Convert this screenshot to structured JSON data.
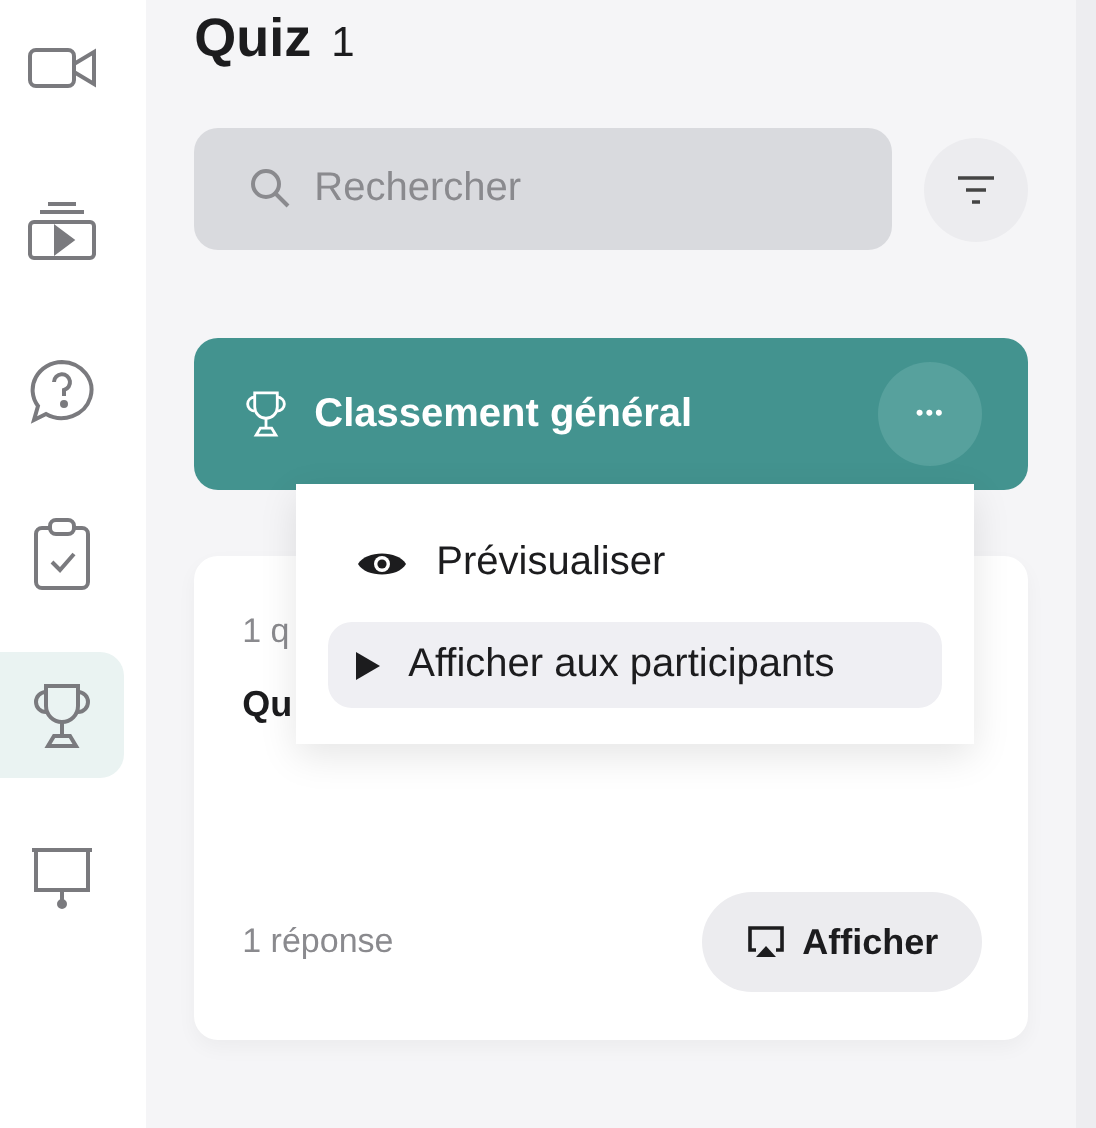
{
  "sidebar": {
    "items": [
      {
        "kind": "video",
        "selected": false
      },
      {
        "kind": "playlist",
        "selected": false
      },
      {
        "kind": "question",
        "selected": false
      },
      {
        "kind": "clipboard",
        "selected": false
      },
      {
        "kind": "trophy",
        "selected": true
      },
      {
        "kind": "presentation",
        "selected": false
      }
    ]
  },
  "header": {
    "title": "Quiz",
    "count": "1"
  },
  "search": {
    "placeholder": "Rechercher"
  },
  "leaderboard": {
    "title": "Classement général",
    "more": "•••"
  },
  "menu": {
    "items": [
      {
        "kind": "eye",
        "label": "Prévisualiser",
        "selected": false
      },
      {
        "kind": "play",
        "label": "Afficher aux participants",
        "selected": true
      }
    ]
  },
  "quiz_card": {
    "meta": "1 q",
    "title": "Qu",
    "responses": "1 réponse",
    "button": "Afficher"
  }
}
